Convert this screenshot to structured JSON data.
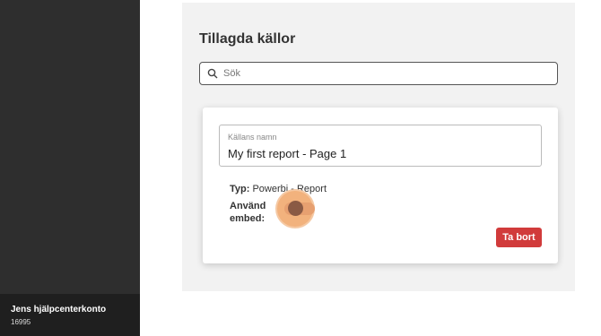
{
  "sidebar": {
    "account_name": "Jens hjälpcenterkonto",
    "account_id": "16995"
  },
  "panel": {
    "title": "Tillagda källor",
    "search": {
      "placeholder": "Sök",
      "icon": "search-icon"
    }
  },
  "source": {
    "name_label": "Källans namn",
    "name_value": "My first report - Page 1",
    "type_label": "Typ:",
    "type_value": "Powerbi - Report",
    "embed_label": "Använd embed:",
    "embed_enabled": false,
    "delete_label": "Ta bort"
  },
  "colors": {
    "sidebar": "#2e2e2e",
    "delete_button": "#d13b3b",
    "toggle_highlight": "#f2b27d"
  }
}
